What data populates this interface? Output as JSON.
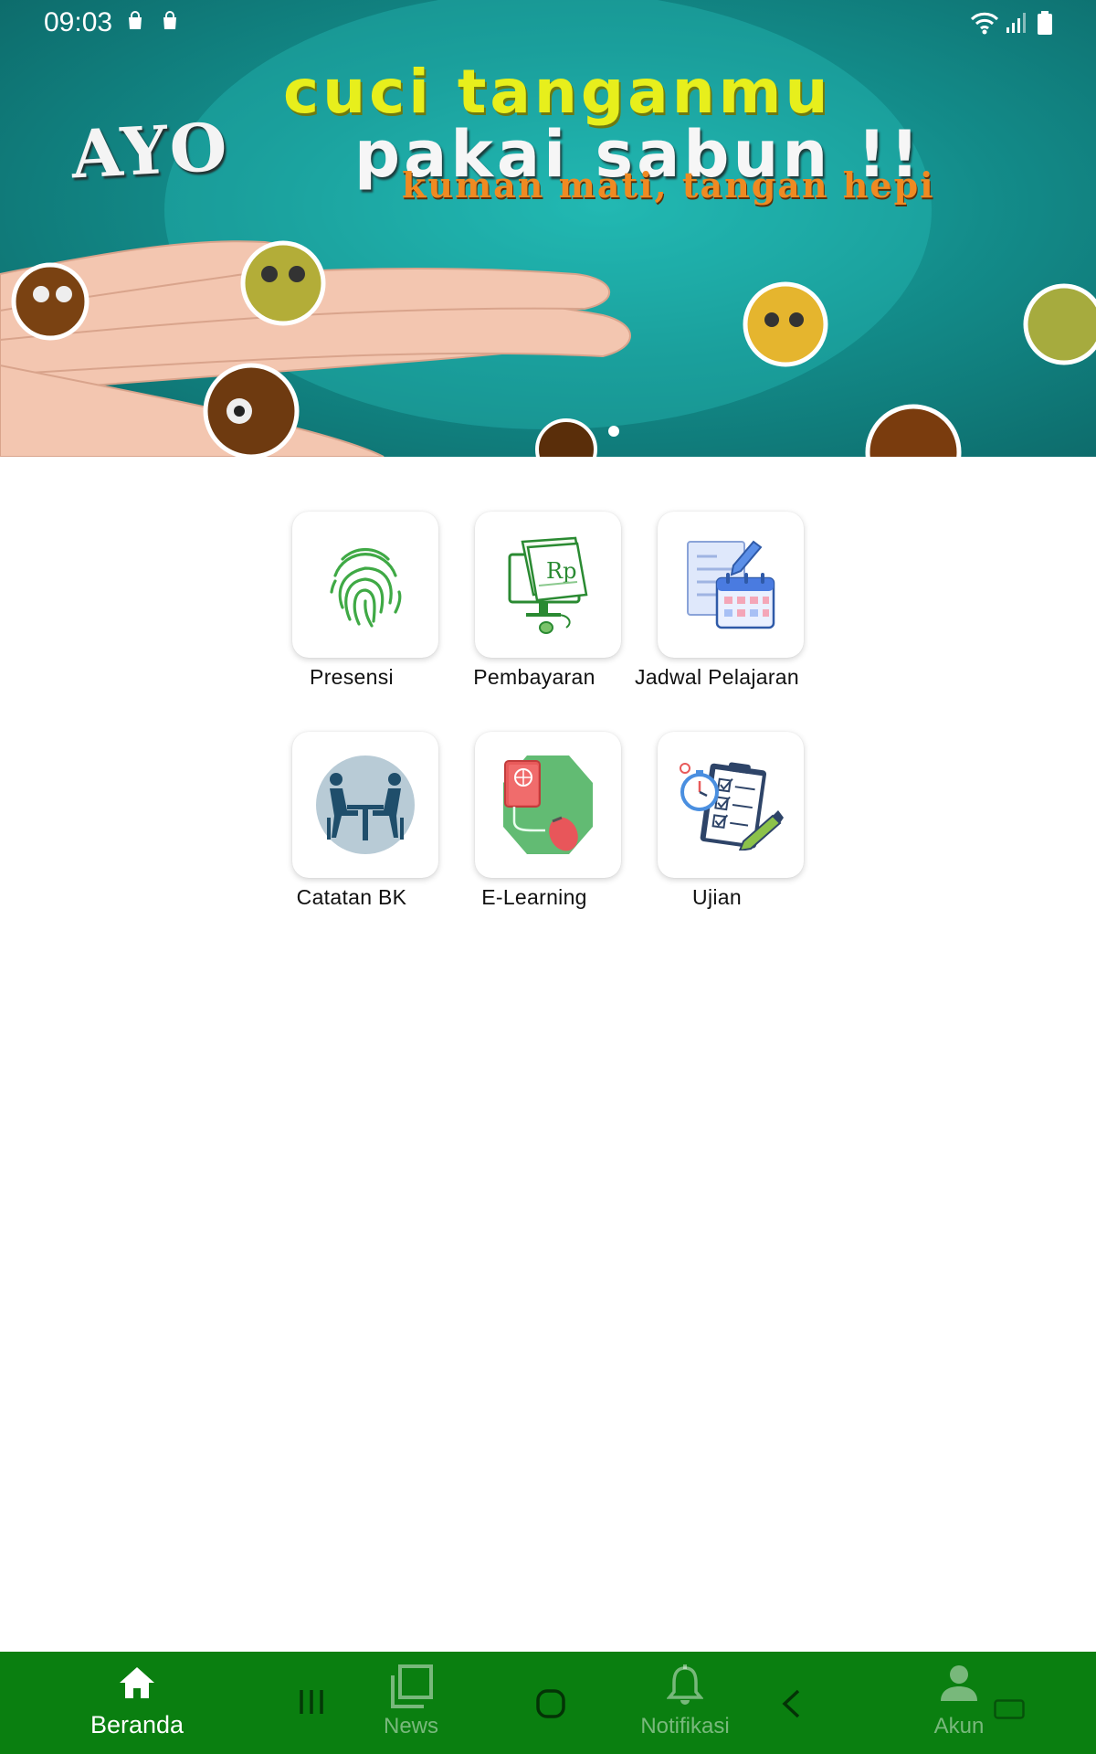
{
  "status_bar": {
    "time": "09:03",
    "left_icons": [
      "shopping-bag-icon",
      "shopping-bag-icon"
    ],
    "right_icons": [
      "wifi-icon",
      "signal-icon",
      "battery-icon"
    ]
  },
  "banner": {
    "line1": "cuci tanganmu",
    "line_ayo": "AYO",
    "line2": "pakai sabun !!",
    "line3": "kuman mati, tangan hepi",
    "slide_count": 1,
    "active_slide": 1
  },
  "menu": {
    "items": [
      {
        "label": "Presensi",
        "icon": "fingerprint-icon"
      },
      {
        "label": "Pembayaran",
        "icon": "payment-rp-icon"
      },
      {
        "label": "Jadwal Pelajaran",
        "icon": "schedule-calendar-icon"
      },
      {
        "label": "Catatan BK",
        "icon": "counseling-icon"
      },
      {
        "label": "E-Learning",
        "icon": "elearning-icon"
      },
      {
        "label": "Ujian",
        "icon": "exam-checklist-icon"
      }
    ]
  },
  "bottom_nav": {
    "items": [
      {
        "label": "Beranda",
        "icon": "home-icon",
        "active": true
      },
      {
        "label": "News",
        "icon": "news-icon",
        "active": false
      },
      {
        "label": "Notifikasi",
        "icon": "bell-icon",
        "active": false
      },
      {
        "label": "Akun",
        "icon": "person-icon",
        "active": false
      }
    ],
    "active_color": "#ffffff",
    "background": "#0a7f10"
  },
  "system_nav": [
    "recent-apps-icon",
    "home-circle-icon",
    "back-icon",
    "keyboard-icon"
  ]
}
